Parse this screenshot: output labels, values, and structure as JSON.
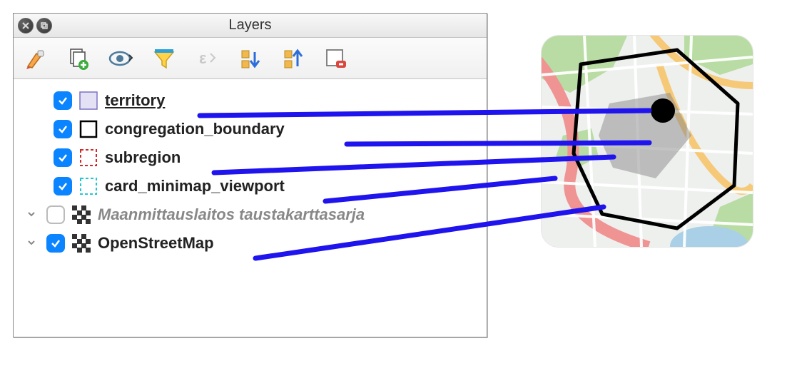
{
  "panel": {
    "title": "Layers"
  },
  "toolbar": {
    "buttons": [
      {
        "name": "style-brush-icon"
      },
      {
        "name": "add-group-icon"
      },
      {
        "name": "toggle-visibility-icon"
      },
      {
        "name": "filter-icon"
      },
      {
        "name": "expression-icon"
      },
      {
        "name": "collapse-all-icon"
      },
      {
        "name": "expand-all-icon"
      },
      {
        "name": "remove-layer-icon"
      }
    ]
  },
  "layers": [
    {
      "id": "territory",
      "label": "territory",
      "checked": true,
      "style": "fill-lavender",
      "underline": true,
      "indent": 1
    },
    {
      "id": "congregation_boundary",
      "label": "congregation_boundary",
      "checked": true,
      "style": "outline-black",
      "indent": 1
    },
    {
      "id": "subregion",
      "label": "subregion",
      "checked": true,
      "style": "dashed-red",
      "indent": 1
    },
    {
      "id": "card_minimap_viewport",
      "label": "card_minimap_viewport",
      "checked": true,
      "style": "dashed-cyan",
      "indent": 1
    },
    {
      "id": "mml",
      "label": "Maanmittauslaitos taustakarttasarja",
      "checked": false,
      "style": "raster",
      "expandable": true,
      "disabled": true,
      "indent": 0
    },
    {
      "id": "osm",
      "label": "OpenStreetMap",
      "checked": true,
      "style": "raster",
      "expandable": true,
      "indent": 0
    }
  ],
  "connector_color": "#1f13ee"
}
